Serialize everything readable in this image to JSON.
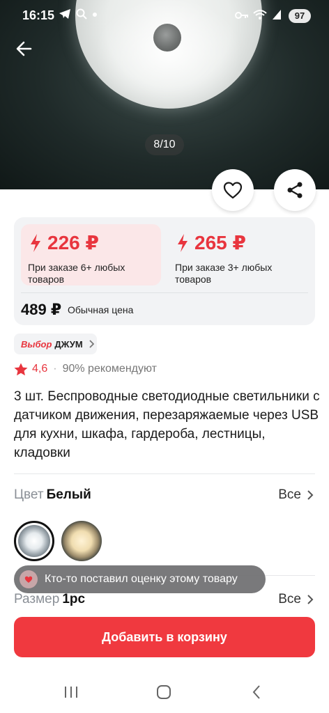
{
  "status_bar": {
    "time": "16:15",
    "left_icons": [
      "telegram-icon",
      "search-icon",
      "dot-icon"
    ],
    "right_icons": [
      "key-icon",
      "wifi-icon",
      "signal-icon"
    ],
    "battery": "97"
  },
  "gallery": {
    "counter": "8/10"
  },
  "prices": {
    "tier1": {
      "price": "226 ₽",
      "note": "При заказе 6+ любых товаров"
    },
    "tier2": {
      "price": "265 ₽",
      "note": "При заказе 3+ любых товаров"
    },
    "regular_price": "489 ₽",
    "regular_label": "Обычная цена",
    "accent_color": "#e8353e"
  },
  "choice_badge": {
    "brand": "Выбор",
    "name": "ДЖУМ"
  },
  "rating": {
    "value": "4,6",
    "recommend": "90% рекомендуют"
  },
  "title": "3 шт. Беспроводные светодиодные светильники с датчиком движения, перезаряжаемые через USB для кухни, шкафа, гардероба, лестницы, кладовки",
  "color": {
    "label": "Цвет",
    "value": "Белый",
    "see_all": "Все"
  },
  "size": {
    "label": "Размер",
    "value": "1pc",
    "see_all": "Все"
  },
  "toast": "Кто-то поставил оценку этому товару",
  "cart_button": "Добавить в корзину",
  "button_color": "#f0393f"
}
